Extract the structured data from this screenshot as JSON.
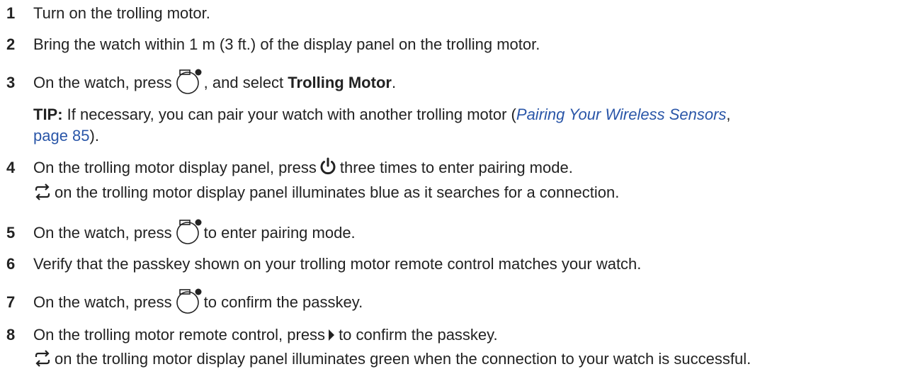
{
  "steps": [
    {
      "num": "1",
      "text": "Turn on the trolling motor."
    },
    {
      "num": "2",
      "text": "Bring the watch within 1 m (3 ft.) of the display panel on the trolling motor."
    },
    {
      "num": "3",
      "pre": "On the watch, press",
      "mid": ", and select ",
      "bold": "Trolling Motor",
      "post": "."
    },
    {
      "num": "4",
      "pre": "On the trolling motor display panel, press",
      "post": "three times to enter pairing mode."
    },
    {
      "num": "5",
      "pre": "On the watch, press",
      "post": "to enter pairing mode."
    },
    {
      "num": "6",
      "text": "Verify that the passkey shown on your trolling motor remote control matches your watch."
    },
    {
      "num": "7",
      "pre": "On the watch, press",
      "post": "to confirm the passkey."
    },
    {
      "num": "8",
      "pre": "On the trolling motor remote control, press",
      "post": "to confirm the passkey."
    }
  ],
  "tip": {
    "label": "TIP:",
    "text": " If necessary, you can pair your watch with another trolling motor (",
    "link_title": "Pairing Your Wireless Sensors",
    "sep": ",",
    "link_page": "page 85",
    "end": ")."
  },
  "notes": {
    "step4": "on the trolling motor display panel illuminates blue as it searches for a connection.",
    "step8": "on the trolling motor display panel illuminates green when the connection to your watch is successful."
  },
  "icons": {
    "watch_button": "watch-button-icon",
    "power": "power-icon",
    "sync": "sync-icon",
    "arrow_right": "arrow-right-icon"
  },
  "colors": {
    "text": "#222222",
    "link": "#2a56a8"
  }
}
